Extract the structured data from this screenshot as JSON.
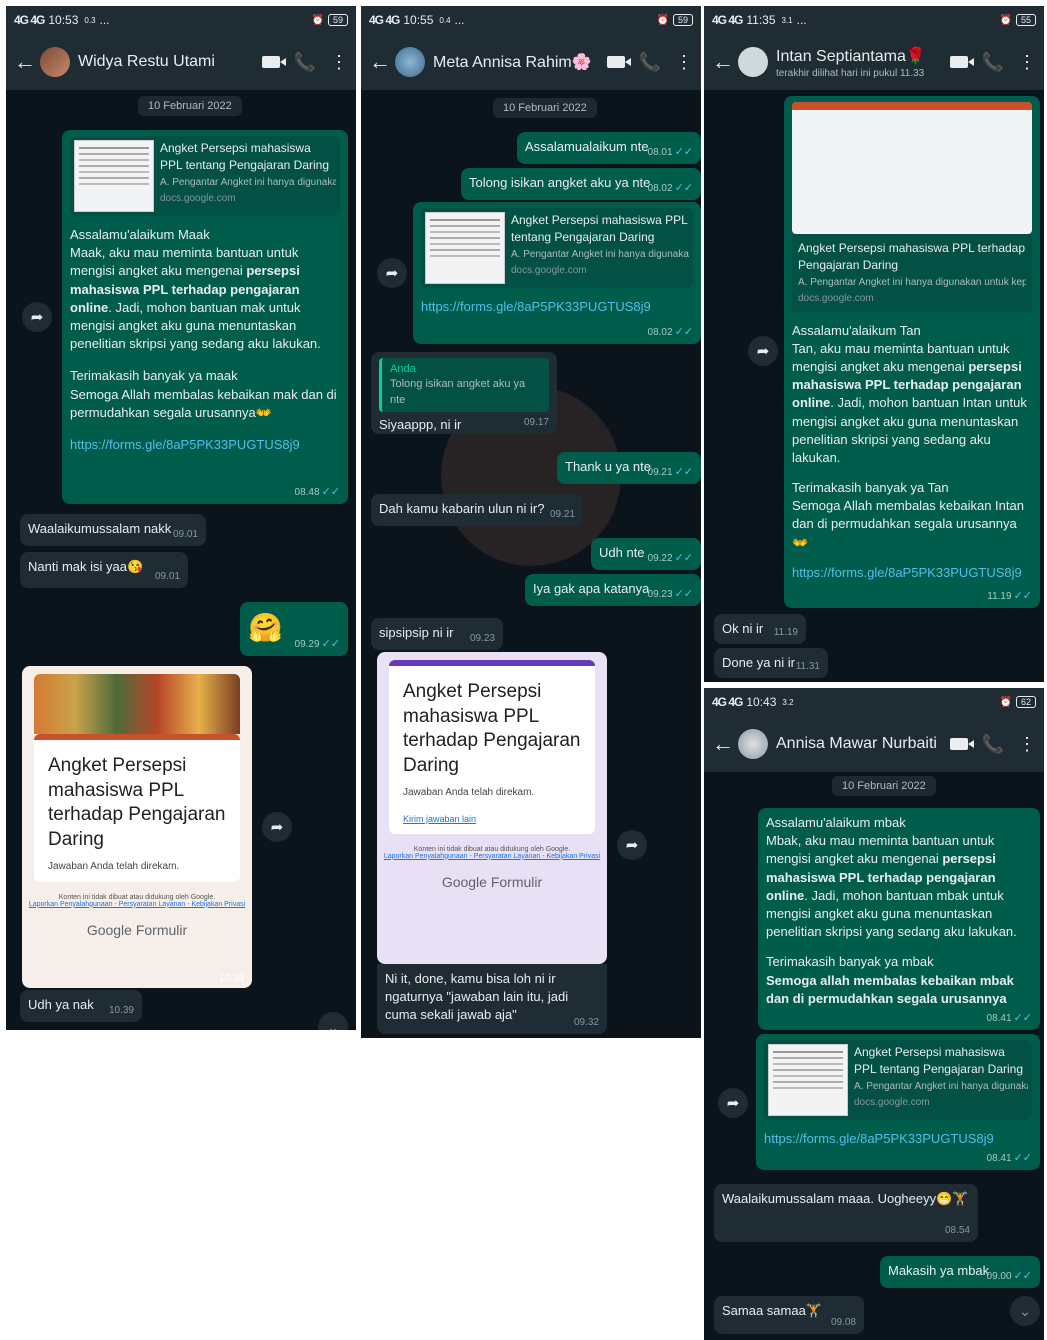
{
  "panel1": {
    "status": {
      "signal": "4G 4G",
      "time": "10:53",
      "data": "0.3",
      "dots": "...",
      "battery": "59"
    },
    "contact": {
      "name": "Widya Restu Utami"
    },
    "date": "10 Februari 2022",
    "preview": {
      "title": "Angket Persepsi mahasiswa PPL tentang Pengajaran Daring",
      "desc": "A. Pengantar Angket ini hanya digunakan u...",
      "domain": "docs.google.com"
    },
    "msg1": {
      "greeting": "Assalamu'alaikum Maak",
      "body_pre": "Maak, aku mau meminta bantuan  untuk mengisi angket aku mengenai ",
      "body_bold": "persepsi mahasiswa PPL terhadap pengajaran online",
      "body_post": ". Jadi, mohon bantuan mak untuk mengisi angket aku guna menuntaskan penelitian skripsi yang sedang aku lakukan.",
      "thanks": "Terimakasih banyak ya maak",
      "pray": "Semoga Allah membalas kebaikan mak dan di permudahkan segala urusannya👐",
      "link": "https://forms.gle/8aP5PK33PUGTUS8j9",
      "time": "08.48"
    },
    "msg2": {
      "text": "Waalaikumussalam nakk",
      "time": "09.01"
    },
    "msg3": {
      "text": "Nanti mak isi yaa😘",
      "time": "09.01"
    },
    "msg4": {
      "text": "🤗",
      "time": "09.29"
    },
    "form": {
      "title": "Angket Persepsi mahasiswa PPL terhadap Pengajaran Daring",
      "response": "Jawaban Anda telah direkam.",
      "notice": "Konten ini tidak dibuat atau didukung oleh Google.",
      "links": "Laporkan Penyalahgunaan - Persyaratan Layanan - Kebijakan Privasi",
      "brand": "Google Formulir",
      "time": "10.39"
    },
    "msg5": {
      "text": "Udh ya nak",
      "time": "10.39"
    }
  },
  "panel2": {
    "status": {
      "signal": "4G 4G",
      "time": "10:55",
      "data": "0.4",
      "dots": "...",
      "battery": "59"
    },
    "contact": {
      "name": "Meta Annisa Rahim🌸"
    },
    "date": "10 Februari 2022",
    "msg1": {
      "text": "Assalamualaikum nte",
      "time": "08.01"
    },
    "msg2": {
      "text": "Tolong isikan angket aku ya nte",
      "time": "08.02"
    },
    "preview": {
      "title": "Angket Persepsi mahasiswa PPL tentang Pengajaran Daring",
      "desc": "A. Pengantar Angket ini hanya digunakan u...",
      "domain": "docs.google.com",
      "link": "https://forms.gle/8aP5PK33PUGTUS8j9",
      "time": "08.02"
    },
    "msg3": {
      "reply_who": "Anda",
      "reply_text": "Tolong isikan angket aku ya nte",
      "text": "Siyaappp, ni ir",
      "time": "09.17"
    },
    "msg4": {
      "text": "Thank u ya nte",
      "time": "09.21"
    },
    "msg5": {
      "text": "Dah kamu kabarin ulun ni ir?",
      "time": "09.21"
    },
    "msg6": {
      "text": "Udh nte",
      "time": "09.22"
    },
    "msg7": {
      "text": "Iya gak apa katanya",
      "time": "09.23"
    },
    "msg8": {
      "text": "sipsipsip ni ir",
      "time": "09.23"
    },
    "form": {
      "title": "Angket Persepsi mahasiswa PPL terhadap Pengajaran Daring",
      "response": "Jawaban Anda telah direkam.",
      "another": "Kirim jawaban lain",
      "notice": "Konten ini tidak dibuat atau didukung oleh Google.",
      "links": "Laporkan Penyalahgunaan - Persyaratan Layanan - Kebijakan Privasi",
      "brand": "Google Formulir"
    },
    "msg9": {
      "text": "Ni it, done, kamu bisa loh ni ir ngaturnya \"jawaban lain itu, jadi cuma sekali jawab aja\"",
      "time": "09.32"
    }
  },
  "panel3": {
    "status": {
      "signal": "4G 4G",
      "time": "11:35",
      "data": "3.1",
      "dots": "...",
      "battery": "55"
    },
    "contact": {
      "name": "Intan Septiantama🌹",
      "last_seen": "terakhir dilihat hari ini pukul 11.33"
    },
    "preview": {
      "title": "Angket Persepsi mahasiswa PPL terhadap Pengajaran Daring",
      "desc": "A. Pengantar Angket ini hanya digunakan untuk kepenti...",
      "domain": "docs.google.com"
    },
    "msg1": {
      "greeting": "Assalamu'alaikum Tan",
      "body_pre": "Tan, aku mau meminta bantuan  untuk mengisi angket aku mengenai ",
      "body_bold": "persepsi mahasiswa PPL terhadap pengajaran online",
      "body_post": ". Jadi, mohon bantuan Intan untuk mengisi angket aku guna menuntaskan penelitian skripsi yang sedang aku lakukan.",
      "thanks": "Terimakasih banyak ya Tan",
      "pray": "Semoga Allah membalas kebaikan Intan dan di permudahkan segala urusannya👐",
      "link": "https://forms.gle/8aP5PK33PUGTUS8j9",
      "time": "11.19"
    },
    "msg2": {
      "text": "Ok ni ir",
      "time": "11.19"
    },
    "msg3": {
      "text": "Done ya ni ir",
      "time": "11.31"
    }
  },
  "panel4": {
    "status": {
      "signal": "4G 4G",
      "time": "10:43",
      "data": "3.2",
      "battery": "62"
    },
    "contact": {
      "name": "Annisa Mawar Nurbaiti"
    },
    "date": "10 Februari 2022",
    "msg1": {
      "greeting": "Assalamu'alaikum mbak",
      "body_pre": "Mbak, aku mau meminta bantuan  untuk mengisi angket aku mengenai ",
      "body_bold": "persepsi mahasiswa PPL terhadap pengajaran online",
      "body_post": ". Jadi, mohon bantuan mbak untuk mengisi angket aku guna menuntaskan penelitian skripsi yang sedang aku lakukan.",
      "thanks": "Terimakasih banyak ya mbak",
      "pray": "Semoga allah membalas kebaikan mbak dan di permudahkan segala urusannya",
      "time": "08.41"
    },
    "preview": {
      "title": "Angket Persepsi mahasiswa PPL tentang Pengajaran Daring",
      "desc": "A. Pengantar Angket ini hanya digunakan u...",
      "domain": "docs.google.com",
      "link": "https://forms.gle/8aP5PK33PUGTUS8j9",
      "time": "08.41"
    },
    "msg2": {
      "text": "Waalaikumussalam maaa. Uogheeyy😁🏋",
      "time": "08.54"
    },
    "msg3": {
      "text": "Makasih ya mbak",
      "time": "09.00"
    },
    "msg4": {
      "text": "Samaa samaa🏋",
      "time": "09.08"
    }
  },
  "icons": {
    "back": "back-arrow-icon",
    "video": "video-call-icon",
    "call": "phone-icon",
    "menu": "more-vert-icon",
    "forward": "forward-icon",
    "scroll": "scroll-down-icon"
  },
  "colors": {
    "bg": "#0b141a",
    "header": "#1f2c34",
    "outgoing": "#005c4b",
    "incoming": "#1f2c34",
    "link": "#53bdeb",
    "ticks": "#53bdeb"
  },
  "glyphs": {
    "back": "←",
    "call": "📞",
    "menu": "⋮",
    "forward": "➦",
    "ticks": "✓✓",
    "scroll": "⌄",
    "alarm": "⏰"
  }
}
